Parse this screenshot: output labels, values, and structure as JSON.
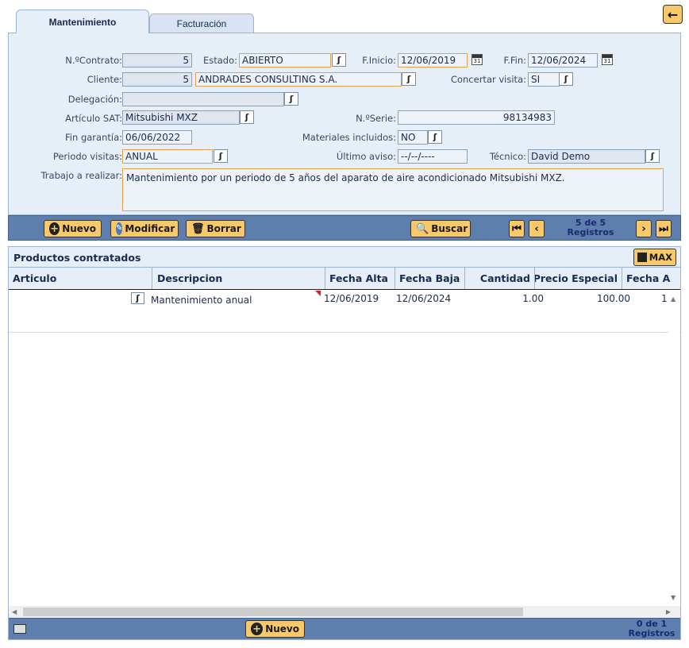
{
  "tabs": {
    "mantenimiento": "Mantenimiento",
    "facturacion": "Facturación"
  },
  "form": {
    "contrato_label": "N.ºContrato:",
    "contrato_value": "5",
    "estado_label": "Estado:",
    "estado_value": "ABIERTO",
    "finicio_label": "F.Inicio:",
    "finicio_value": "12/06/2019",
    "ffin_label": "F.Fin:",
    "ffin_value": "12/06/2024",
    "cliente_label": "Cliente:",
    "cliente_id": "5",
    "cliente_name": "ANDRADES CONSULTING S.A.",
    "concertar_label": "Concertar visita:",
    "concertar_value": "SI",
    "delegacion_label": "Delegación:",
    "delegacion_value": "",
    "articulo_label": "Artículo SAT:",
    "articulo_value": "Mitsubishi MXZ",
    "serie_label": "N.ºSerie:",
    "serie_value": "98134983",
    "garantia_label": "Fin garantía:",
    "garantia_value": "06/06/2022",
    "materiales_label": "Materiales incluidos:",
    "materiales_value": "NO",
    "periodo_label": "Periodo visitas:",
    "periodo_value": "ANUAL",
    "aviso_label": "Último aviso:",
    "aviso_value": "--/--/----",
    "tecnico_label": "Técnico:",
    "tecnico_value": "David Demo",
    "trabajo_label": "Trabajo a realizar:",
    "trabajo_value": "Mantenimiento por un periodo de 5 años del aparato de aire acondicionado Mitsubishi MXZ."
  },
  "toolbar": {
    "nuevo": "Nuevo",
    "modificar": "Modificar",
    "borrar": "Borrar",
    "buscar": "Buscar",
    "reg_count": "5 de 5",
    "reg_label": "Registros"
  },
  "products": {
    "title": "Productos contratados",
    "max": "MAX",
    "columns": [
      "Articulo",
      "Descripcion",
      "Fecha Alta",
      "Fecha Baja",
      "Cantidad",
      "Precio Especial",
      "Fecha A"
    ],
    "rows": [
      {
        "articulo": "",
        "descripcion": "Mantenimiento anual",
        "fecha_alta": "12/06/2019",
        "fecha_baja": "12/06/2024",
        "cantidad": "1.00",
        "precio": "100.00",
        "fecha_a": "1"
      }
    ],
    "nuevo": "Nuevo",
    "reg_count": "0 de 1",
    "reg_label": "Registros"
  },
  "icons": {
    "lookup": "lookup-icon",
    "calendar": "calendar-icon",
    "back": "back-arrow-icon"
  },
  "colors": {
    "button": "#f7c96a",
    "toolbar": "#5e7fae",
    "panel": "#e6eef8",
    "highlight_border": "#e3a050"
  }
}
